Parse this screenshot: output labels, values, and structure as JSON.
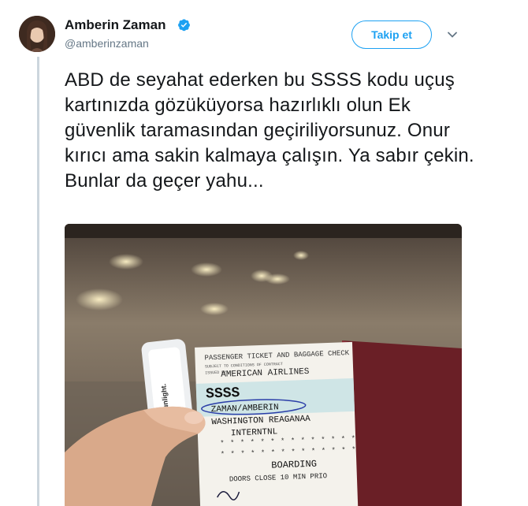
{
  "tweet": {
    "author_name": "Amberin Zaman",
    "handle": "@amberinzaman",
    "follow_label": "Takip et",
    "text": "ABD de seyahat ederken bu SSSS kodu uçuş kartınızda gözüküyorsa hazırlıklı olun Ek güvenlik taramasından geçiriliyorsunuz. Onur kırıcı ama sakin kalmaya çalışın. Ya sabır çekin. Bunlar da geçer yahu..."
  },
  "photo": {
    "ticket_header": "PASSENGER TICKET AND BAGGAGE CHECK",
    "ticket_subheader": "SUBJECT TO CONDITIONS OF CONTRACT",
    "issued_by": "ISSUED BY",
    "airline": "AMERICAN AIRLINES",
    "ssss_code": "SSSS",
    "passenger": "ZAMAN/AMBERIN",
    "origin": "WASHINGTON REAGANAA",
    "intl": "INTERNTNL",
    "boarding": "BOARDING",
    "doors": "DOORS CLOSE 10 MIN PRIO",
    "sunlight": "sunlight."
  },
  "icons": [
    "verified-badge-icon",
    "chevron-down-icon"
  ],
  "colors": {
    "accent": "#1da1f2",
    "text": "#14171a",
    "muted": "#657786"
  }
}
